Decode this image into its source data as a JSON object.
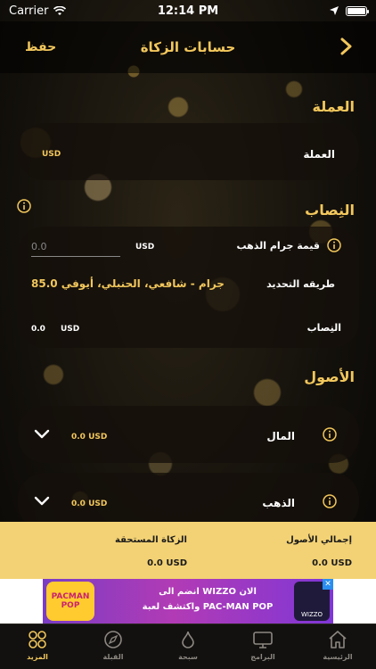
{
  "status_bar": {
    "carrier": "Carrier",
    "time": "12:14 PM"
  },
  "navbar": {
    "title": "حسابات الزكاة",
    "save_label": "حفظ"
  },
  "currency_section": {
    "title": "العملة",
    "row_label": "العملة",
    "row_value": "USD"
  },
  "nisab_section": {
    "title": "النِصاب",
    "gram_price_label": "قيمة جرام الذهب",
    "gram_price_currency": "USD",
    "gram_price_placeholder": "0.0",
    "method_label": "طريقه التحديد",
    "method_value": "85.0 جرام - شافعي، الحنبلي، أيوفي",
    "nisab_label": "النِصاب",
    "nisab_currency": "USD",
    "nisab_value": "0.0"
  },
  "assets_section": {
    "title": "الأصول",
    "items": [
      {
        "label": "المال",
        "value": "0.0 USD"
      },
      {
        "label": "الذهب",
        "value": "0.0 USD"
      }
    ]
  },
  "summary": {
    "total_assets_label": "إجمالي الأصول",
    "total_assets_value": "0.0 USD",
    "zakat_due_label": "الزكاة المستحقة",
    "zakat_due_value": "0.0 USD"
  },
  "ad": {
    "left_logo_text": "PACMAN POP",
    "line1": "انضم الى WIZZO الان",
    "line2": "واكتشف لعبة PAC-MAN POP",
    "right_logo_text": "WIZZO",
    "close_glyph": "✕"
  },
  "tabbar": {
    "items": [
      {
        "label": "الرئيسية",
        "icon": "home-icon"
      },
      {
        "label": "البرامج",
        "icon": "tv-icon"
      },
      {
        "label": "سبحة",
        "icon": "drop-icon"
      },
      {
        "label": "القبلة",
        "icon": "compass-icon"
      },
      {
        "label": "المزيد",
        "icon": "more-grid-icon"
      }
    ],
    "active_index": 4
  },
  "colors": {
    "accent": "#f2c75c",
    "summary_bg": "#f3d275",
    "tab_inactive": "#8c8780"
  }
}
